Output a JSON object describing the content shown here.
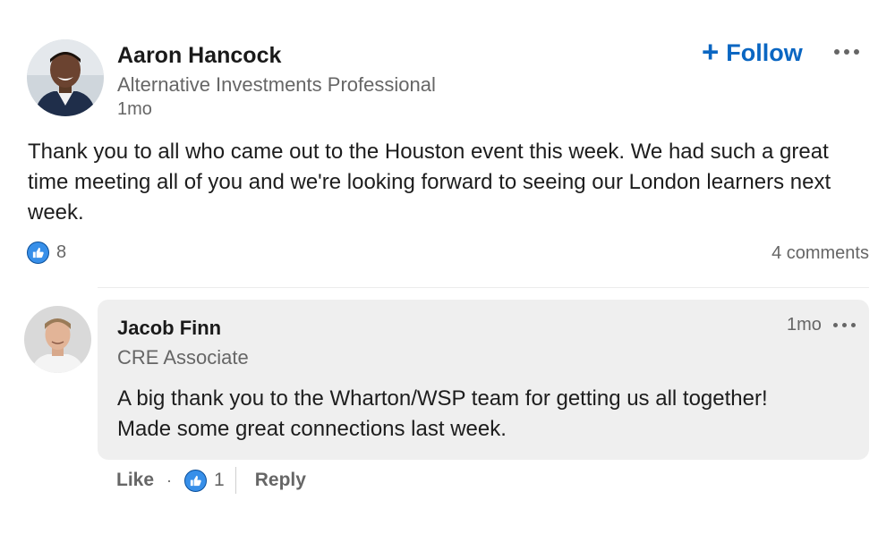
{
  "post": {
    "author": {
      "name": "Aaron Hancock",
      "headline": "Alternative Investments Professional",
      "time": "1mo",
      "avatar_icon": "person-avatar-photo"
    },
    "follow_label": "Follow",
    "follow_icon": "plus-icon",
    "more_icon": "more-options-icon",
    "body": "Thank you to all who came out to the Houston event this week. We had such a great time meeting all of you and we're looking forward to seeing our London learners next week.",
    "reactions": {
      "icon": "like-reaction-icon",
      "count": "8"
    },
    "comments_label": "4 comments"
  },
  "comment": {
    "author": {
      "name": "Jacob Finn",
      "headline": "CRE Associate",
      "time": "1mo",
      "avatar_icon": "person-avatar-photo"
    },
    "more_icon": "more-options-icon",
    "text_line1": "A big thank you to the Wharton/WSP team for getting us all together!",
    "text_line2": "Made some great connections last week.",
    "actions": {
      "like_label": "Like",
      "separator": "·",
      "reaction_count": "1",
      "reply_label": "Reply"
    }
  },
  "colors": {
    "accent": "#0a66c2",
    "like_badge": "#378fe9",
    "secondary_text": "#666666",
    "comment_bg": "#efefef"
  }
}
